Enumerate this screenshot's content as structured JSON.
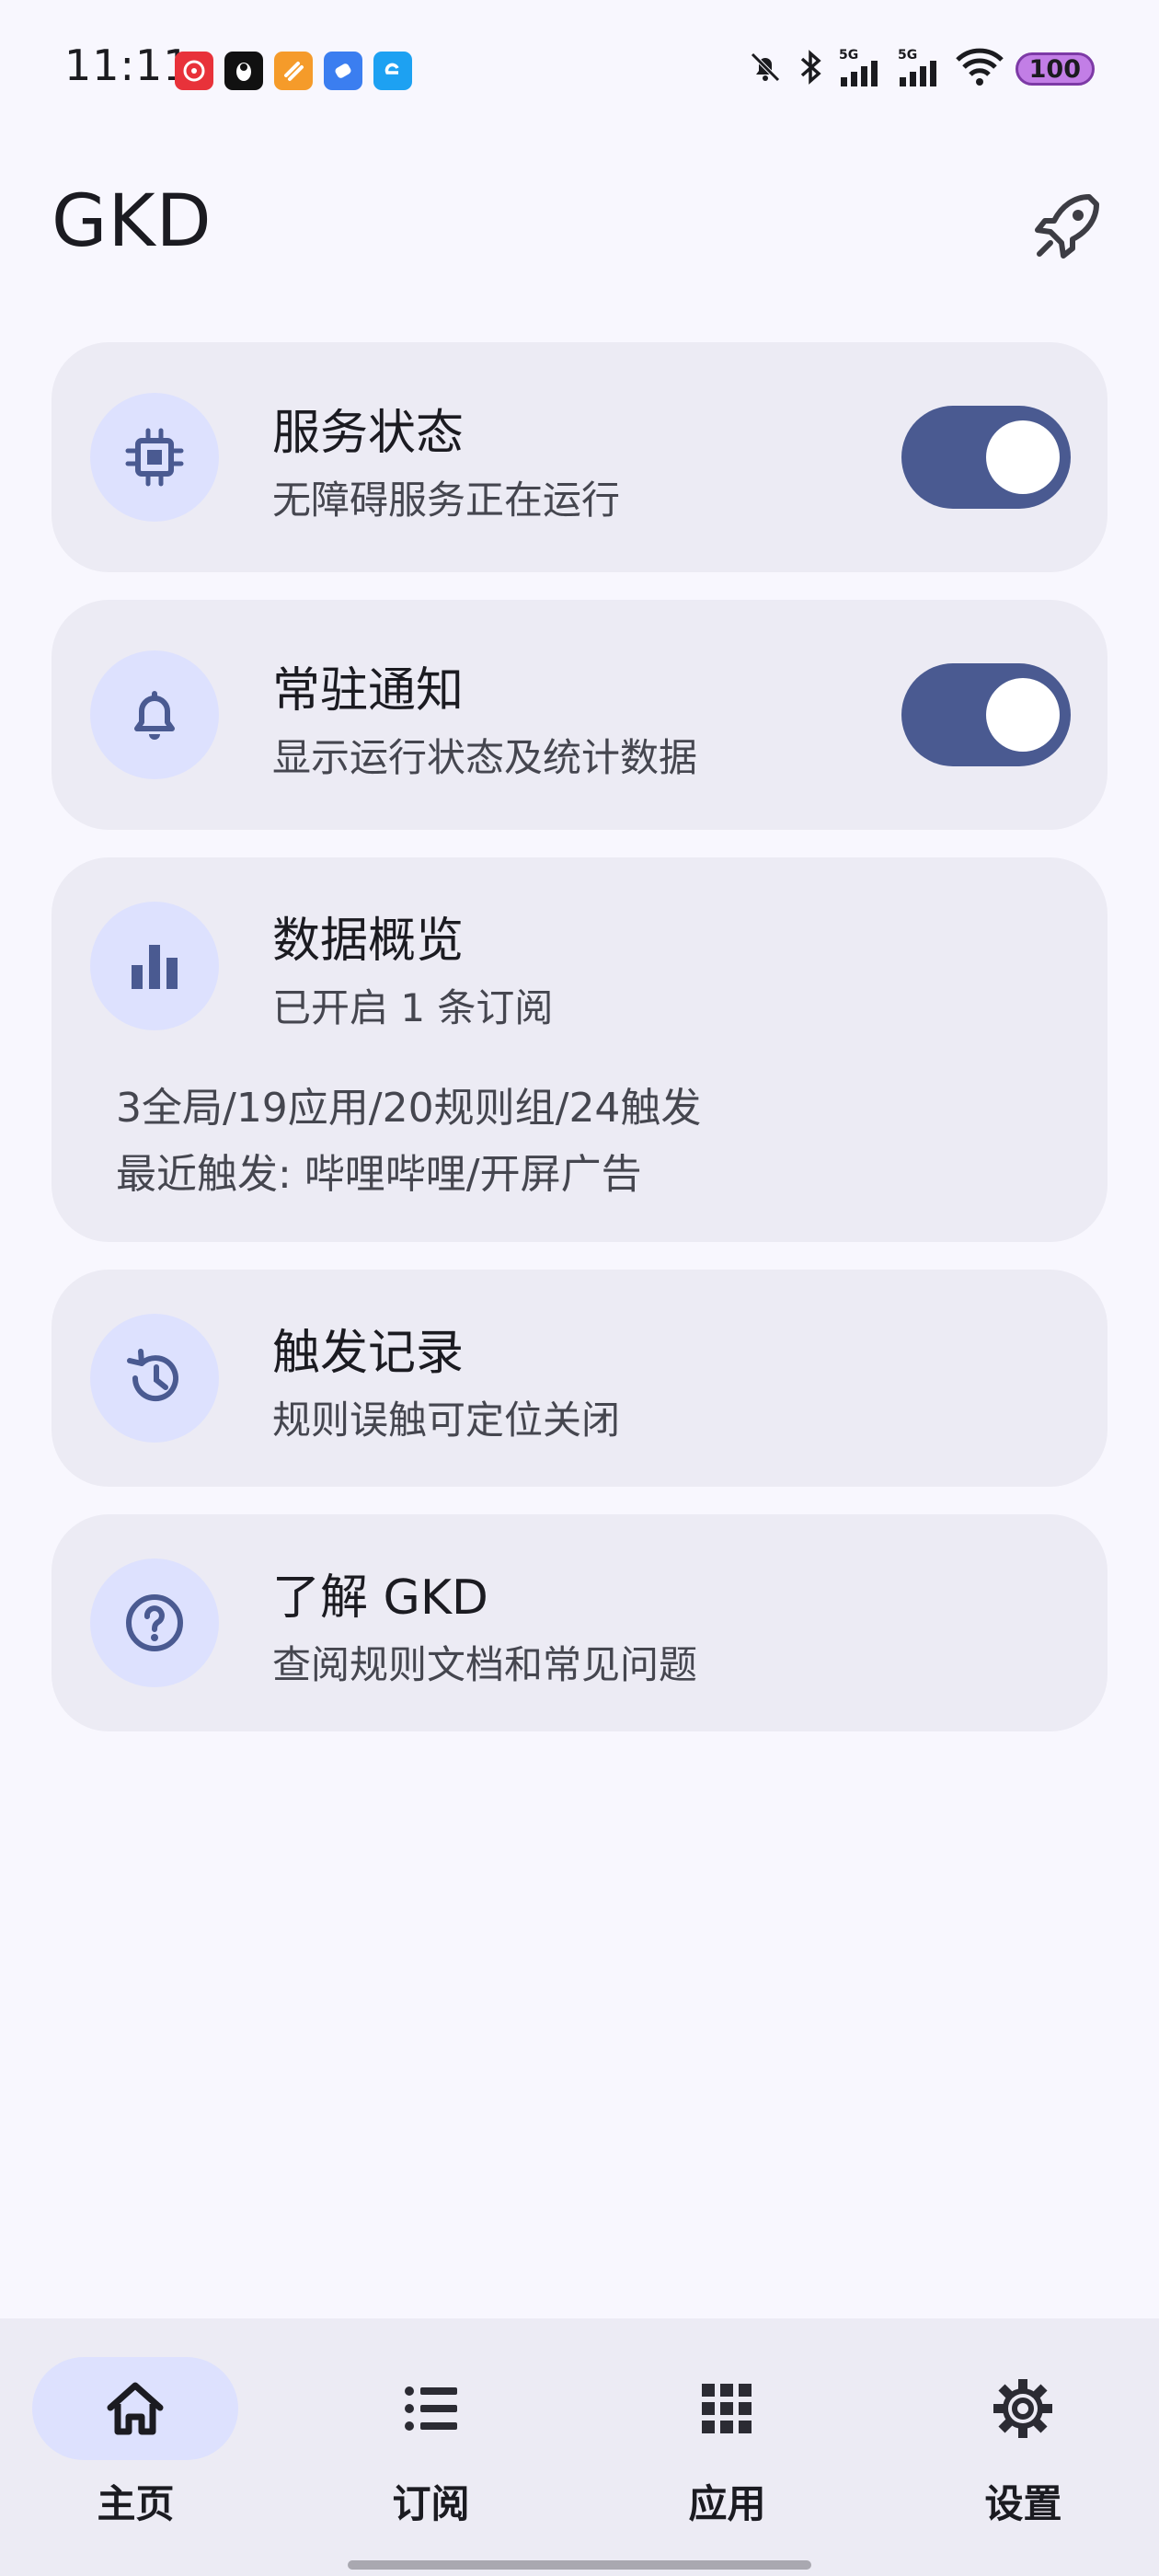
{
  "status_bar": {
    "time": "11:11",
    "battery": "100",
    "network_labels": [
      "5G",
      "5G"
    ],
    "notification_icons": [
      "netease-music-icon",
      "penguin-app-icon",
      "orange-app-icon",
      "blue-app-icon",
      "browser-e-icon"
    ],
    "indicator_icons": [
      "mute-bell-icon",
      "bluetooth-icon",
      "signal-5g-icon",
      "signal-5g-icon",
      "wifi-icon"
    ]
  },
  "app_bar": {
    "title": "GKD",
    "action_icon": "rocket-icon"
  },
  "cards": {
    "service": {
      "title": "服务状态",
      "subtitle": "无障碍服务正在运行",
      "icon": "cpu-chip-icon",
      "enabled": true
    },
    "notification": {
      "title": "常驻通知",
      "subtitle": "显示运行状态及统计数据",
      "icon": "bell-icon",
      "enabled": true
    },
    "data": {
      "title": "数据概览",
      "subtitle": "已开启 1 条订阅",
      "stats": "3全局/19应用/20规则组/24触发",
      "recent": "最近触发: 哔哩哔哩/开屏广告",
      "icon": "bar-chart-icon"
    },
    "history": {
      "title": "触发记录",
      "subtitle": "规则误触可定位关闭",
      "icon": "history-icon"
    },
    "about": {
      "title": "了解 GKD",
      "subtitle": "查阅规则文档和常见问题",
      "icon": "help-circle-icon"
    }
  },
  "bottom_nav": {
    "items": [
      {
        "label": "主页",
        "icon": "home-icon",
        "selected": true
      },
      {
        "label": "订阅",
        "icon": "list-icon",
        "selected": false
      },
      {
        "label": "应用",
        "icon": "apps-grid-icon",
        "selected": false
      },
      {
        "label": "设置",
        "icon": "gear-icon",
        "selected": false
      }
    ]
  },
  "colors": {
    "background": "#f8f7fe",
    "card": "#ecebf4",
    "icon_container": "#dde1fe",
    "switch_track": "#4a5a91",
    "icon_tint": "#4a5a91"
  }
}
